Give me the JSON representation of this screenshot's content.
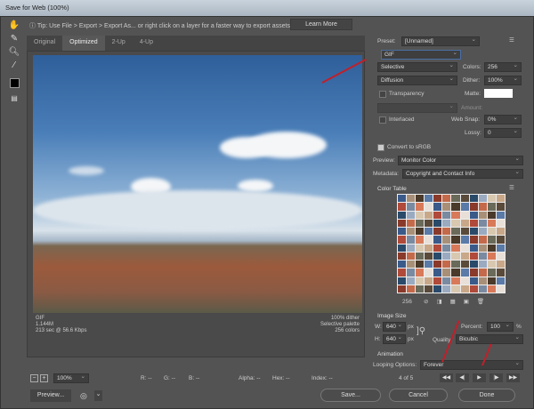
{
  "window": {
    "title": "Save for Web (100%)"
  },
  "tip": {
    "text": "Tip: Use File > Export > Export As... or right click on a layer for a faster way to export assets",
    "learn_more": "Learn More"
  },
  "tabs": [
    "Original",
    "Optimized",
    "2-Up",
    "4-Up"
  ],
  "image_info": {
    "format": "GIF",
    "size": "1.144M",
    "time": "213 sec @ 56.6 Kbps",
    "dither": "100% dither",
    "palette": "Selective palette",
    "colors": "256 colors"
  },
  "statusbar": {
    "zoom": "100%",
    "r": "R: --",
    "g": "G: --",
    "b": "B: --",
    "alpha": "Alpha: --",
    "hex": "Hex: --",
    "index": "Index: --"
  },
  "buttons": {
    "preview": "Preview...",
    "save": "Save...",
    "cancel": "Cancel",
    "done": "Done"
  },
  "settings": {
    "preset_label": "Preset:",
    "preset": "[Unnamed]",
    "format": "GIF",
    "reduction": "Selective",
    "colors_label": "Colors:",
    "colors": "256",
    "dither_algo": "Diffusion",
    "dither_label": "Dither:",
    "dither": "100%",
    "transparency": "Transparency",
    "matte_label": "Matte:",
    "amount_label": "Amount:",
    "interlaced": "Interlaced",
    "websnap_label": "Web Snap:",
    "websnap": "0%",
    "lossy_label": "Lossy:",
    "lossy": "0",
    "convert_srgb": "Convert to sRGB",
    "preview_label": "Preview:",
    "preview": "Monitor Color",
    "metadata_label": "Metadata:",
    "metadata": "Copyright and Contact Info"
  },
  "color_table": {
    "title": "Color Table",
    "count": "256"
  },
  "image_size": {
    "title": "Image Size",
    "w_label": "W:",
    "w": "640",
    "h_label": "H:",
    "h": "640",
    "unit": "px",
    "percent_label": "Percent:",
    "percent": "100",
    "percent_unit": "%",
    "quality_label": "Quality:",
    "quality": "Bicubic"
  },
  "animation": {
    "title": "Animation",
    "looping_label": "Looping Options:",
    "looping": "Forever",
    "frame": "4 of 5"
  },
  "colors": {
    "accent_arrow": "#c0202a",
    "panel": "#535353"
  }
}
